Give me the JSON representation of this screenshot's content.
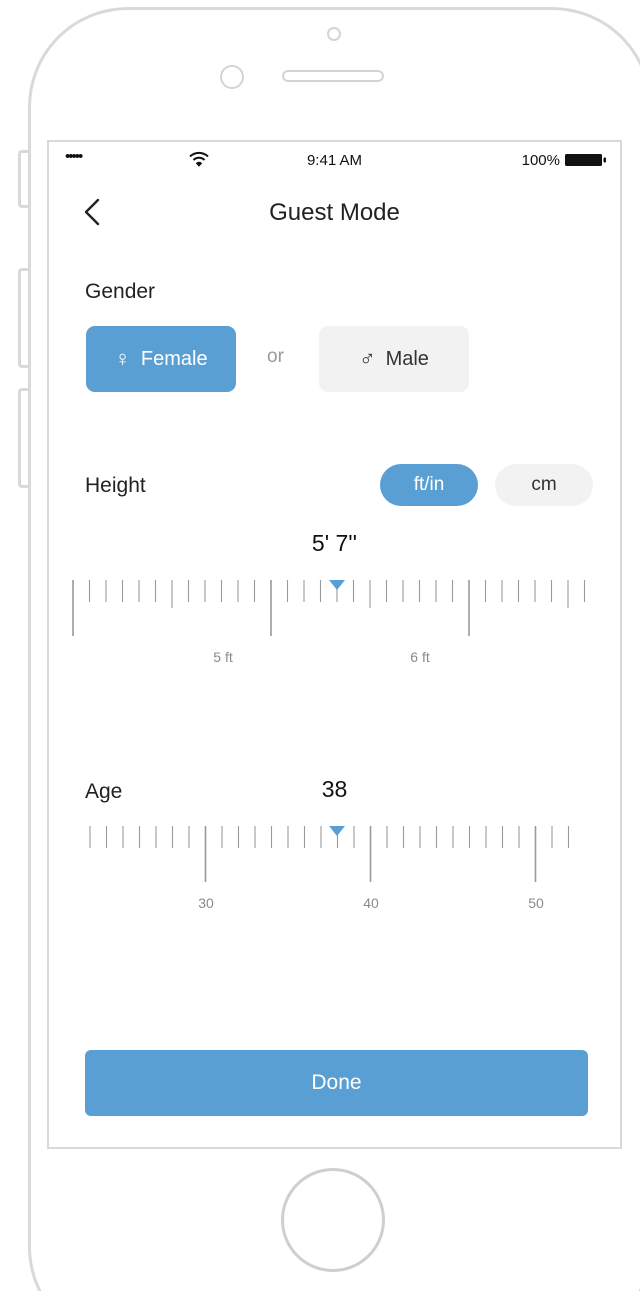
{
  "status_bar": {
    "signal": "•••••",
    "time": "9:41 AM",
    "battery": "100%"
  },
  "nav": {
    "title": "Guest Mode"
  },
  "gender": {
    "label": "Gender",
    "female_label": "Female",
    "male_label": "Male",
    "or_text": "or",
    "selected": "female"
  },
  "height": {
    "label": "Height",
    "unit_ftin": "ft/in",
    "unit_cm": "cm",
    "selected_unit": "ft/in",
    "value_text": "5' 7''",
    "tick_labels": [
      "5 ft",
      "6 ft"
    ]
  },
  "age": {
    "label": "Age",
    "value_text": "38",
    "tick_labels": [
      "30",
      "40",
      "50"
    ]
  },
  "done_label": "Done",
  "colors": {
    "accent": "#5a9fd4",
    "tick": "#9a9a9a",
    "tick_label": "#8a8a8a"
  },
  "icons": {
    "back": "chevron-left-icon",
    "wifi": "wifi-icon",
    "battery": "battery-icon",
    "female": "female-symbol-icon",
    "male": "male-symbol-icon",
    "pointer": "triangle-down-icon"
  }
}
